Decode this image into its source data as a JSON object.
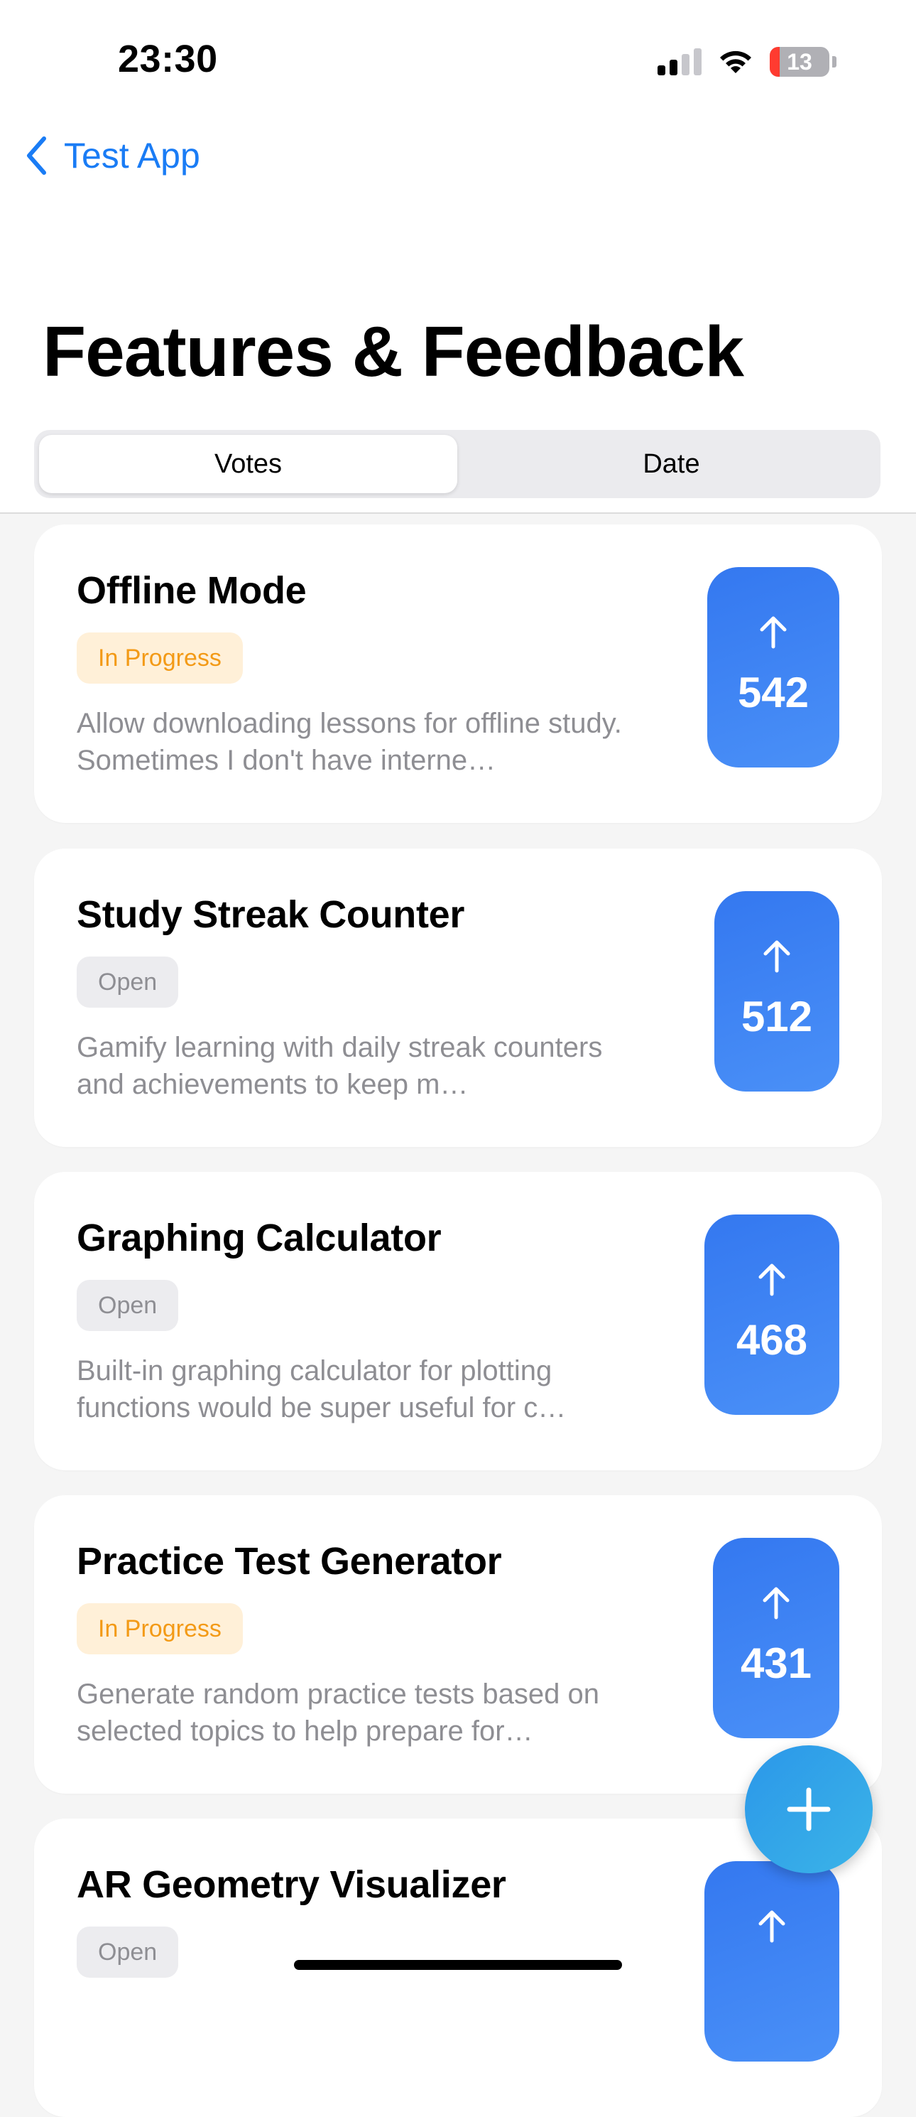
{
  "status_bar": {
    "time": "23:30",
    "battery": "13",
    "icons": [
      "cellular-signal-icon",
      "wifi-icon",
      "battery-icon"
    ],
    "battery_color": "#ff3b30"
  },
  "nav": {
    "back_label": "Test App",
    "back_icon": "chevron-left-icon",
    "accent_color": "#1a7cf5"
  },
  "page": {
    "title": "Features & Feedback"
  },
  "sort": {
    "options": [
      {
        "label": "Votes",
        "selected": true
      },
      {
        "label": "Date",
        "selected": false
      }
    ]
  },
  "features": [
    {
      "title": "Offline Mode",
      "status": "In Progress",
      "status_type": "in-progress",
      "description": "Allow downloading lessons for offline study. Sometimes I don't have interne…",
      "votes": "542"
    },
    {
      "title": "Study Streak Counter",
      "status": "Open",
      "status_type": "open",
      "description": "Gamify learning with daily streak counters and achievements to keep m…",
      "votes": "512"
    },
    {
      "title": "Graphing Calculator",
      "status": "Open",
      "status_type": "open",
      "description": "Built-in graphing calculator for plotting functions would be super useful for c…",
      "votes": "468"
    },
    {
      "title": "Practice Test Generator",
      "status": "In Progress",
      "status_type": "in-progress",
      "description": "Generate random practice tests based on selected topics to help prepare for…",
      "votes": "431"
    },
    {
      "title": "AR Geometry Visualizer",
      "status": "Open",
      "status_type": "open",
      "description": "",
      "votes": ""
    }
  ],
  "fab": {
    "icon": "plus-icon",
    "color": "#2b97e9"
  },
  "colors": {
    "vote_button": "#3478f0",
    "in_progress_text": "#f39a16",
    "in_progress_bg": "#fff0d8",
    "open_text": "#8e8e93",
    "open_bg": "#ececef"
  }
}
